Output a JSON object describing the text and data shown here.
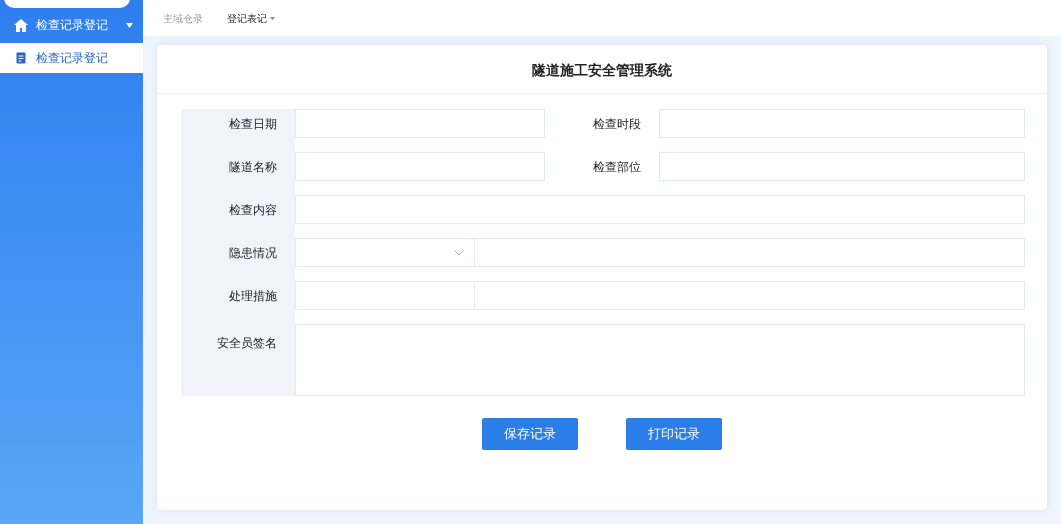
{
  "sidebar": {
    "group": {
      "label": "检查记录登记",
      "expanded": true,
      "items": [
        {
          "label": "检查记录登记",
          "selected": true
        }
      ]
    }
  },
  "breadcrumbs": [
    {
      "label": "主域仓录",
      "selected": false,
      "caret": false
    },
    {
      "label": "登记表记",
      "selected": true,
      "caret": true
    }
  ],
  "form": {
    "title": "隧道施工安全管理系统",
    "rows": [
      {
        "kind": "pair",
        "fields": [
          {
            "label": "检查日期"
          },
          {
            "label": "检查时段"
          }
        ]
      },
      {
        "kind": "pair",
        "fields": [
          {
            "label": "隧道名称"
          },
          {
            "label": "检查部位"
          }
        ]
      },
      {
        "kind": "wide",
        "fields": [
          {
            "label": "检查内容"
          }
        ]
      },
      {
        "kind": "select",
        "fields": [
          {
            "label": "隐患情况"
          }
        ]
      },
      {
        "kind": "short",
        "fields": [
          {
            "label": "处理措施"
          }
        ]
      },
      {
        "kind": "textarea",
        "fields": [
          {
            "label": "安全员签名"
          }
        ]
      }
    ],
    "buttons": [
      {
        "label": "保存记录"
      },
      {
        "label": "打印记录"
      }
    ]
  }
}
